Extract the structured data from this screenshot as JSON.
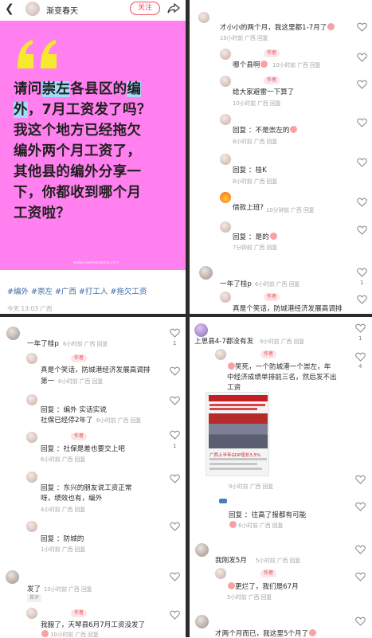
{
  "post": {
    "author_name": "渐变春天",
    "follow_label": "关注",
    "title_before": "请问",
    "title_hl1": "崇左",
    "title_mid": "各县区的",
    "title_hl2a": "编",
    "title_hl2b": "外",
    "title_after1": "，7月工资发了吗？",
    "title_line3": "我这个地方已经拖欠",
    "title_line4": "编外两个月工资了，",
    "title_line5": "其他县的编外分享一",
    "title_line6": "下，你都收到哪个月",
    "title_line7": "工资啦？",
    "watermark": "www.xiaohongshu.com",
    "tags": "#编外 #崇左 #广西 #打工人 #拖欠工资",
    "time": "今天 13:03 广西",
    "cover_color": "#ff80ee",
    "highlight_color": "#9fdcf5"
  },
  "panel2": {
    "c1_text": "才小小的两个月，我这里都1-7月了",
    "c1_meta": "10小时前 广西  回复",
    "author_badge": "作者",
    "c2_text": "哪个县啊",
    "c2_meta": "10小时前 广西  回复",
    "c3_text": "给大家避雷一下算了",
    "c3_meta": "10小时前 广西  回复",
    "c4_text": "回复 ：不是崇左的",
    "c4_meta": "8小时前 广西  回复",
    "c5_text": "回复 ：桂K",
    "c5_meta": "8小时前 广西  回复",
    "c6_text": "借款上班?",
    "c6_meta": "10分钟前 广西  回复",
    "c7_text": "回复 ：是的",
    "c7_meta": "7分钟前 广西  回复",
    "c8_text": "一年了桂p",
    "c8_meta": "6小时前 广西  回复",
    "c9_text": "真是个笑话，防城港经济发展高调排",
    "like1": "1"
  },
  "panel3": {
    "c1_text": "一年了桂p",
    "c1_meta": "6小时前 广西  回复",
    "author_badge": "作者",
    "c2_text": "真是个笑话，防城港经济发展高调排",
    "c2_text2": "第一",
    "c2_meta": "6小时前 广西  回复",
    "c3_text": "回复 ：编外 实话实说",
    "c3_text2": "社保已经停2年了",
    "c3_meta": "6小时前 广西  回复",
    "c4_text": "回复 ：社保是差也要交上吧",
    "c4_meta": "6小时前 广西  回复",
    "c5_text": "回复 ：东兴的朋友说工资正常",
    "c5_text2": "呀，绩效也有，编外",
    "c5_meta": "4小时前 广西  回复",
    "c6_text": "回复 ：防城的",
    "c6_meta": "1小时前 广西  回复",
    "c7_text": "发了",
    "c7_meta": "10小时前 广西  回复",
    "c7_badge": "首评",
    "c8_text": "我服了，天琴县6月7月工资没发了",
    "c8_meta": "10小时前 广西  回复",
    "like1": "1"
  },
  "panel4": {
    "c1_text": "上思县4-7都没有发",
    "c1_meta": "9小时前 广西  回复",
    "like_a": "1",
    "like_b": "4",
    "author_badge": "作者",
    "c2_text": "笑死，一个防城港一个崇左，年",
    "c2_text2": "中经济成绩单排前三名，然后发不出",
    "c2_text3": "工资",
    "news_caption": "广西上半年GDP增长3.5%",
    "c2_meta": "9小时前 广西  回复",
    "c3_text": "回复 ：往高了报都有可能",
    "c3_meta": "6小时前 广西  回复",
    "c4_text": "我刚发5月",
    "c4_meta": "5小时前 广西  回复",
    "c5_text": "更烂了，我们是67月",
    "c5_meta": "5小时前 广西  回复",
    "c6_text": "才两个月而已，我这里5个月了"
  }
}
